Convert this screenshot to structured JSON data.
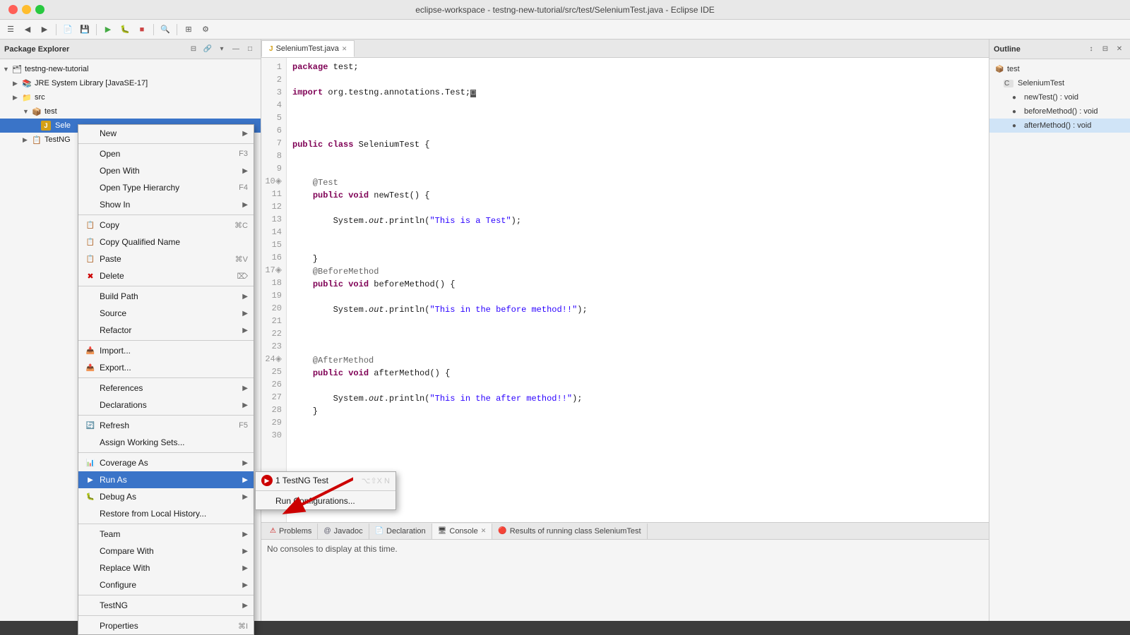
{
  "titlebar": {
    "title": "eclipse-workspace - testng-new-tutorial/src/test/SeleniumTest.java - Eclipse IDE"
  },
  "left_panel": {
    "title": "Package Explorer",
    "tree": [
      {
        "id": "root",
        "label": "testng-new-tutorial",
        "level": 0,
        "icon": "📁",
        "arrow": "▼"
      },
      {
        "id": "jre",
        "label": "JRE System Library [JavaSE-17]",
        "level": 1,
        "icon": "📚",
        "arrow": "▶"
      },
      {
        "id": "src",
        "label": "src",
        "level": 1,
        "icon": "📁",
        "arrow": "▶"
      },
      {
        "id": "test",
        "label": "test",
        "level": 2,
        "icon": "📦",
        "arrow": "▼"
      },
      {
        "id": "seleni",
        "label": "SeleniumTest.java",
        "level": 3,
        "icon": "J",
        "selected": true
      },
      {
        "id": "testng",
        "label": "TestNG",
        "level": 2,
        "icon": "📋",
        "arrow": "▶"
      }
    ]
  },
  "context_menu": {
    "items": [
      {
        "id": "new",
        "label": "New",
        "has_arrow": true,
        "icon": ""
      },
      {
        "id": "sep1",
        "type": "sep"
      },
      {
        "id": "open",
        "label": "Open",
        "shortcut": "F3"
      },
      {
        "id": "open_with",
        "label": "Open With",
        "has_arrow": true
      },
      {
        "id": "open_type_hier",
        "label": "Open Type Hierarchy",
        "shortcut": "F4"
      },
      {
        "id": "show_in",
        "label": "Show In",
        "has_arrow": true
      },
      {
        "id": "sep2",
        "type": "sep"
      },
      {
        "id": "copy",
        "label": "Copy",
        "shortcut": "⌘C",
        "icon": "📋"
      },
      {
        "id": "copy_qual",
        "label": "Copy Qualified Name",
        "icon": "📋"
      },
      {
        "id": "paste",
        "label": "Paste",
        "shortcut": "⌘V",
        "icon": "📋"
      },
      {
        "id": "delete",
        "label": "Delete",
        "shortcut": "⌦",
        "icon": "❌"
      },
      {
        "id": "sep3",
        "type": "sep"
      },
      {
        "id": "build_path",
        "label": "Build Path",
        "has_arrow": true
      },
      {
        "id": "source",
        "label": "Source",
        "has_arrow": true
      },
      {
        "id": "refactor",
        "label": "Refactor",
        "has_arrow": true
      },
      {
        "id": "sep4",
        "type": "sep"
      },
      {
        "id": "import",
        "label": "Import...",
        "icon": "📥"
      },
      {
        "id": "export",
        "label": "Export...",
        "icon": "📤"
      },
      {
        "id": "sep5",
        "type": "sep"
      },
      {
        "id": "references",
        "label": "References",
        "has_arrow": true
      },
      {
        "id": "declarations",
        "label": "Declarations",
        "has_arrow": true
      },
      {
        "id": "sep6",
        "type": "sep"
      },
      {
        "id": "refresh",
        "label": "Refresh",
        "shortcut": "F5",
        "icon": "🔄"
      },
      {
        "id": "assign_ws",
        "label": "Assign Working Sets..."
      },
      {
        "id": "sep7",
        "type": "sep"
      },
      {
        "id": "coverage",
        "label": "Coverage As",
        "has_arrow": true,
        "icon": "📊"
      },
      {
        "id": "run_as",
        "label": "Run As",
        "has_arrow": true,
        "icon": "▶",
        "highlighted": true
      },
      {
        "id": "debug_as",
        "label": "Debug As",
        "has_arrow": true,
        "icon": "🐛"
      },
      {
        "id": "restore",
        "label": "Restore from Local History..."
      },
      {
        "id": "sep8",
        "type": "sep"
      },
      {
        "id": "team",
        "label": "Team",
        "has_arrow": true
      },
      {
        "id": "compare",
        "label": "Compare With",
        "has_arrow": true
      },
      {
        "id": "replace",
        "label": "Replace With",
        "has_arrow": true
      },
      {
        "id": "configure",
        "label": "Configure",
        "has_arrow": true
      },
      {
        "id": "sep9",
        "type": "sep"
      },
      {
        "id": "testng",
        "label": "TestNG",
        "has_arrow": true
      },
      {
        "id": "sep10",
        "type": "sep"
      },
      {
        "id": "properties",
        "label": "Properties",
        "shortcut": "⌘I"
      }
    ]
  },
  "run_as_submenu": {
    "items": [
      {
        "id": "testng_test",
        "label": "1 TestNG Test",
        "shortcut": "⌥⇧X N",
        "icon": "🔴"
      },
      {
        "id": "run_configs",
        "label": "Run Configurations..."
      }
    ]
  },
  "editor": {
    "tab_label": "SeleniumTest.java",
    "lines": [
      {
        "num": 1,
        "text": "package test;",
        "tokens": [
          {
            "type": "kw",
            "text": "package"
          },
          {
            "type": "plain",
            "text": " test;"
          }
        ]
      },
      {
        "num": 2,
        "text": ""
      },
      {
        "num": 3,
        "text": "import org.testng.annotations.Test;",
        "tokens": [
          {
            "type": "kw",
            "text": "import"
          },
          {
            "type": "plain",
            "text": " org.testng.annotations.Test;"
          }
        ]
      },
      {
        "num": 4,
        "text": ""
      },
      {
        "num": 5,
        "text": ""
      },
      {
        "num": 6,
        "text": ""
      },
      {
        "num": 7,
        "text": "public class SeleniumTest {"
      },
      {
        "num": 8,
        "text": ""
      },
      {
        "num": 9,
        "text": ""
      },
      {
        "num": 10,
        "text": "    @Test",
        "ann": true
      },
      {
        "num": 11,
        "text": "    public void newTest() {"
      },
      {
        "num": 12,
        "text": ""
      },
      {
        "num": 13,
        "text": "        System.out.println(\"This is a Test\");"
      },
      {
        "num": 14,
        "text": ""
      },
      {
        "num": 15,
        "text": ""
      },
      {
        "num": 16,
        "text": "    }"
      },
      {
        "num": 17,
        "text": "    @BeforeMethod",
        "ann": true
      },
      {
        "num": 18,
        "text": "    public void beforeMethod() {"
      },
      {
        "num": 19,
        "text": ""
      },
      {
        "num": 20,
        "text": "        System.out.println(\"This in the before method!!\");"
      },
      {
        "num": 21,
        "text": ""
      },
      {
        "num": 22,
        "text": ""
      },
      {
        "num": 23,
        "text": ""
      },
      {
        "num": 24,
        "text": "    @AfterMethod",
        "ann": true
      },
      {
        "num": 25,
        "text": "    public void afterMethod() {"
      },
      {
        "num": 26,
        "text": ""
      },
      {
        "num": 27,
        "text": "        System.out.println(\"This in the after method!!\");"
      },
      {
        "num": 28,
        "text": "    }"
      },
      {
        "num": 29,
        "text": ""
      },
      {
        "num": 30,
        "text": ""
      }
    ]
  },
  "bottom_panel": {
    "tabs": [
      "Problems",
      "@ Javadoc",
      "Declaration",
      "Console",
      "Results of running class SeleniumTest"
    ],
    "active_tab": "Console",
    "console_text": "No consoles to display at this time."
  },
  "outline_panel": {
    "title": "Outline",
    "items": [
      {
        "label": "test",
        "level": 0,
        "icon": "📦"
      },
      {
        "label": "SeleniumTest",
        "level": 1,
        "icon": "C"
      },
      {
        "label": "newTest() : void",
        "level": 2,
        "icon": "●"
      },
      {
        "label": "beforeMethod() : void",
        "level": 2,
        "icon": "●"
      },
      {
        "label": "afterMethod() : void",
        "level": 2,
        "icon": "●",
        "selected": true
      }
    ]
  }
}
